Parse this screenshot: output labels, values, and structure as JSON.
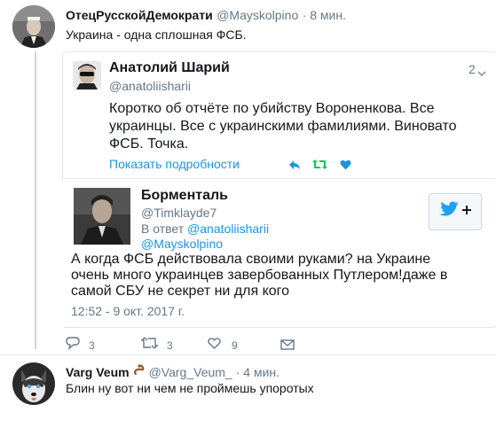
{
  "main_tweet": {
    "name": "ОтецРусскойДемократи",
    "handle": "@Mayskolpino",
    "time": "· 8 мин.",
    "text": "Украина - одна сплошная ФСБ."
  },
  "quoted_tweet": {
    "name": "Анатолий Шарий",
    "handle": "@anatoliisharii",
    "time": "2",
    "text_lines": [
      "Коротко об отчёте по убийству Вороненкова. Все",
      "украинцы. Все с украинскими фамилиями. Виновато",
      "ФСБ. Точка."
    ],
    "show_details": "Показать подробности"
  },
  "reply_card": {
    "name": "Борменталь",
    "handle": "@Timklayde7",
    "in_reply_prefix": "В ответ",
    "reply_to_1": "@anatoliisharii",
    "reply_to_2": "@Mayskolpino",
    "text_lines": [
      "А когда ФСБ действовала своими руками? на Украине",
      "очень много украинцев завербованных Путлером!даже в",
      "самой СБУ не секрет ни для кого"
    ],
    "date": "12:52 - 9 окт. 2017 г."
  },
  "actions": {
    "replies": "3",
    "retweets": "3",
    "likes": "9"
  },
  "reply_tweet": {
    "name": "Varg Veum",
    "handle": "@Varg_Veum_",
    "time": "· 4 мин.",
    "text": "Блин ну вот ни чем не проймешь упоротых"
  },
  "colors": {
    "accent": "#1b95e0",
    "retweet_green": "#17bf63",
    "muted": "#657786",
    "border": "#e1e8ed"
  }
}
